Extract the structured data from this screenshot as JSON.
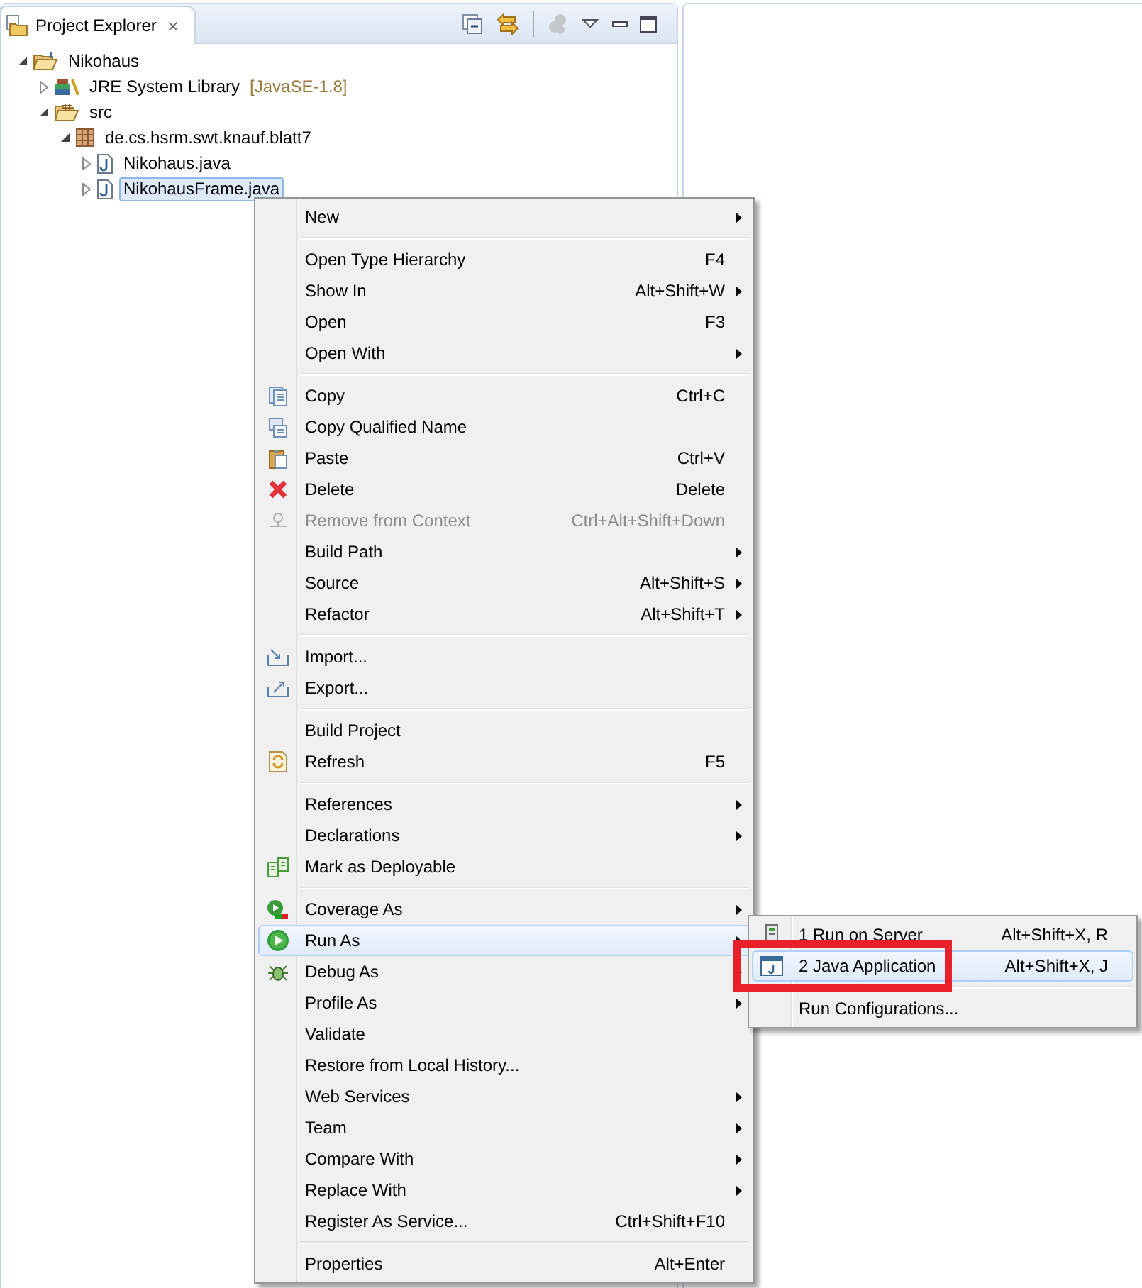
{
  "view": {
    "title": "Project Explorer",
    "close": "⨯"
  },
  "tree": [
    {
      "label": "Nikohaus",
      "kind": "project",
      "expanded": true,
      "selected": false,
      "children": [
        {
          "label": "JRE System Library",
          "decoration": "[JavaSE-1.8]",
          "kind": "library",
          "expanded": false,
          "selected": false
        },
        {
          "label": "src",
          "kind": "source",
          "expanded": true,
          "selected": false,
          "children": [
            {
              "label": "de.cs.hsrm.swt.knauf.blatt7",
              "kind": "package",
              "expanded": true,
              "selected": false,
              "children": [
                {
                  "label": "Nikohaus.java",
                  "kind": "file",
                  "expanded": false,
                  "selected": false
                },
                {
                  "label": "NikohausFrame.java",
                  "kind": "file",
                  "expanded": false,
                  "selected": true
                }
              ]
            }
          ]
        }
      ]
    }
  ],
  "menu": {
    "items": [
      {
        "kind": "item",
        "label": "New",
        "submenu": true,
        "disabled": false,
        "selected": false
      },
      {
        "kind": "separator"
      },
      {
        "kind": "item",
        "label": "Open Type Hierarchy",
        "shortcut": "F4",
        "submenu": false,
        "disabled": false,
        "selected": false
      },
      {
        "kind": "item",
        "label": "Show In",
        "shortcut": "Alt+Shift+W",
        "submenu": true,
        "disabled": false,
        "selected": false
      },
      {
        "kind": "item",
        "label": "Open",
        "shortcut": "F3",
        "submenu": false,
        "disabled": false,
        "selected": false
      },
      {
        "kind": "item",
        "label": "Open With",
        "submenu": true,
        "disabled": false,
        "selected": false
      },
      {
        "kind": "separator"
      },
      {
        "kind": "item",
        "label": "Copy",
        "shortcut": "Ctrl+C",
        "submenu": false,
        "disabled": false,
        "selected": false
      },
      {
        "kind": "item",
        "label": "Copy Qualified Name",
        "submenu": false,
        "disabled": false,
        "selected": false
      },
      {
        "kind": "item",
        "label": "Paste",
        "shortcut": "Ctrl+V",
        "submenu": false,
        "disabled": false,
        "selected": false
      },
      {
        "kind": "item",
        "label": "Delete",
        "shortcut": "Delete",
        "submenu": false,
        "disabled": false,
        "selected": false
      },
      {
        "kind": "item",
        "label": "Remove from Context",
        "shortcut": "Ctrl+Alt+Shift+Down",
        "submenu": false,
        "disabled": true,
        "selected": false
      },
      {
        "kind": "item",
        "label": "Build Path",
        "submenu": true,
        "disabled": false,
        "selected": false
      },
      {
        "kind": "item",
        "label": "Source",
        "shortcut": "Alt+Shift+S",
        "submenu": true,
        "disabled": false,
        "selected": false
      },
      {
        "kind": "item",
        "label": "Refactor",
        "shortcut": "Alt+Shift+T",
        "submenu": true,
        "disabled": false,
        "selected": false
      },
      {
        "kind": "separator"
      },
      {
        "kind": "item",
        "label": "Import...",
        "submenu": false,
        "disabled": false,
        "selected": false
      },
      {
        "kind": "item",
        "label": "Export...",
        "submenu": false,
        "disabled": false,
        "selected": false
      },
      {
        "kind": "separator"
      },
      {
        "kind": "item",
        "label": "Build Project",
        "submenu": false,
        "disabled": false,
        "selected": false
      },
      {
        "kind": "item",
        "label": "Refresh",
        "shortcut": "F5",
        "submenu": false,
        "disabled": false,
        "selected": false
      },
      {
        "kind": "separator"
      },
      {
        "kind": "item",
        "label": "References",
        "submenu": true,
        "disabled": false,
        "selected": false
      },
      {
        "kind": "item",
        "label": "Declarations",
        "submenu": true,
        "disabled": false,
        "selected": false
      },
      {
        "kind": "item",
        "label": "Mark as Deployable",
        "submenu": false,
        "disabled": false,
        "selected": false
      },
      {
        "kind": "separator"
      },
      {
        "kind": "item",
        "label": "Coverage As",
        "submenu": true,
        "disabled": false,
        "selected": false
      },
      {
        "kind": "item",
        "label": "Run As",
        "submenu": true,
        "disabled": false,
        "selected": true
      },
      {
        "kind": "item",
        "label": "Debug As",
        "submenu": true,
        "disabled": false,
        "selected": false
      },
      {
        "kind": "item",
        "label": "Profile As",
        "submenu": true,
        "disabled": false,
        "selected": false
      },
      {
        "kind": "item",
        "label": "Validate",
        "submenu": false,
        "disabled": false,
        "selected": false
      },
      {
        "kind": "item",
        "label": "Restore from Local History...",
        "submenu": false,
        "disabled": false,
        "selected": false
      },
      {
        "kind": "item",
        "label": "Web Services",
        "submenu": true,
        "disabled": false,
        "selected": false
      },
      {
        "kind": "item",
        "label": "Team",
        "submenu": true,
        "disabled": false,
        "selected": false
      },
      {
        "kind": "item",
        "label": "Compare With",
        "submenu": true,
        "disabled": false,
        "selected": false
      },
      {
        "kind": "item",
        "label": "Replace With",
        "submenu": true,
        "disabled": false,
        "selected": false
      },
      {
        "kind": "item",
        "label": "Register As Service...",
        "shortcut": "Ctrl+Shift+F10",
        "submenu": false,
        "disabled": false,
        "selected": false
      },
      {
        "kind": "separator"
      },
      {
        "kind": "item",
        "label": "Properties",
        "shortcut": "Alt+Enter",
        "submenu": false,
        "disabled": false,
        "selected": false
      }
    ]
  },
  "run_as_submenu": {
    "items": [
      {
        "kind": "item",
        "label": "1 Run on Server",
        "shortcut": "Alt+Shift+X, R",
        "submenu": false,
        "disabled": false,
        "selected": false
      },
      {
        "kind": "item",
        "label": "2 Java Application",
        "shortcut": "Alt+Shift+X, J",
        "submenu": false,
        "disabled": false,
        "selected": true
      },
      {
        "kind": "separator"
      },
      {
        "kind": "item",
        "label": "Run Configurations...",
        "submenu": false,
        "disabled": false,
        "selected": false
      }
    ]
  }
}
